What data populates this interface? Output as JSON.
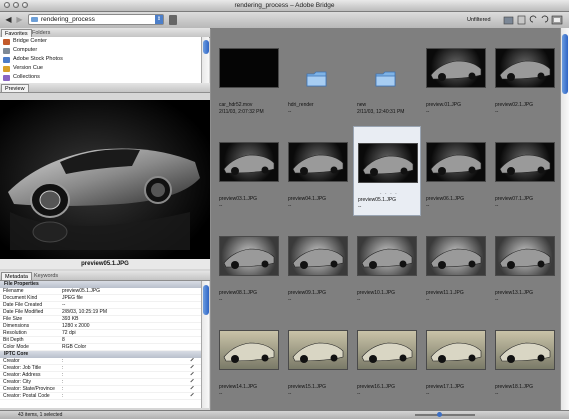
{
  "window": {
    "title": "rendering_process – Adobe Bridge"
  },
  "toolbar": {
    "back_icon": "◀",
    "forward_icon": "▶",
    "path": "rendering_process",
    "filter": "Unfiltered",
    "icons": [
      "new-folder-icon",
      "trash-icon",
      "rotate-left-icon",
      "rotate-right-icon",
      "view-mode-icon"
    ]
  },
  "panels": {
    "favorites_tabs": [
      "Favorites",
      "Folders"
    ],
    "favorites": [
      {
        "label": "Bridge Center",
        "color": "#c35a2a"
      },
      {
        "label": "Computer",
        "color": "#7f8a96"
      },
      {
        "label": "Adobe Stock Photos",
        "color": "#4c7cc9"
      },
      {
        "label": "Version Cue",
        "color": "#d8a12a"
      },
      {
        "label": "Collections",
        "color": "#8a66c2"
      }
    ],
    "preview_tab": "Preview",
    "preview_caption": "preview05.1.JPG",
    "meta_tabs": [
      "Metadata",
      "Keywords"
    ]
  },
  "metadata": {
    "file_properties_title": "File Properties",
    "file_properties": [
      {
        "k": "Filename",
        "v": "preview05.1.JPG"
      },
      {
        "k": "Document Kind",
        "v": "JPEG file"
      },
      {
        "k": "Date File Created",
        "v": "--"
      },
      {
        "k": "Date File Modified",
        "v": "2/8/03, 10:25:19 PM"
      },
      {
        "k": "File Size",
        "v": "393 KB"
      },
      {
        "k": "Dimensions",
        "v": "1280 x 2000"
      },
      {
        "k": "Resolution",
        "v": "72 dpi"
      },
      {
        "k": "Bit Depth",
        "v": "8"
      },
      {
        "k": "Color Mode",
        "v": "RGB Color"
      }
    ],
    "iptc_title": "IPTC Core",
    "iptc": [
      {
        "k": "Creator",
        "v": ":"
      },
      {
        "k": "Creator: Job Title",
        "v": ":"
      },
      {
        "k": "Creator: Address",
        "v": ":"
      },
      {
        "k": "Creator: City",
        "v": ":"
      },
      {
        "k": "Creator: State/Province",
        "v": ":"
      },
      {
        "k": "Creator: Postal Code",
        "v": ":"
      }
    ]
  },
  "status": {
    "text": "43 items, 1 selected"
  },
  "files": [
    {
      "name": "car_hdr52.mov",
      "date": "2/11/03, 2:07:32 PM",
      "kind": "movie"
    },
    {
      "name": "hdri_render",
      "date": "--",
      "kind": "folder"
    },
    {
      "name": "new",
      "date": "2/11/03, 12:40:31 PM",
      "kind": "folder"
    },
    {
      "name": "preview.01.JPG",
      "date": "--",
      "kind": "dark"
    },
    {
      "name": "preview02.1.JPG",
      "date": "--",
      "kind": "dark"
    },
    {
      "name": "preview03.1.JPG",
      "date": "--",
      "kind": "dark"
    },
    {
      "name": "preview04.1.JPG",
      "date": "--",
      "kind": "dark"
    },
    {
      "name": "preview05.1.JPG",
      "date": "--",
      "kind": "dark",
      "selected": true,
      "stars": "· · · ·"
    },
    {
      "name": "preview06.1.JPG",
      "date": "--",
      "kind": "dark"
    },
    {
      "name": "preview07.1.JPG",
      "date": "--",
      "kind": "dark"
    },
    {
      "name": "preview08.1.JPG",
      "date": "--",
      "kind": "mid"
    },
    {
      "name": "preview09.1.JPG",
      "date": "--",
      "kind": "mid"
    },
    {
      "name": "preview10.1.JPG",
      "date": "--",
      "kind": "mid"
    },
    {
      "name": "preview11.1.JPG",
      "date": "--",
      "kind": "mid"
    },
    {
      "name": "preview13.1.JPG",
      "date": "--",
      "kind": "mid"
    },
    {
      "name": "preview14.1.JPG",
      "date": "--",
      "kind": "light"
    },
    {
      "name": "preview15.1.JPG",
      "date": "--",
      "kind": "light"
    },
    {
      "name": "preview16.1.JPG",
      "date": "--",
      "kind": "light"
    },
    {
      "name": "preview17.1.JPG",
      "date": "--",
      "kind": "light"
    },
    {
      "name": "preview18.1.JPG",
      "date": "--",
      "kind": "light"
    }
  ]
}
